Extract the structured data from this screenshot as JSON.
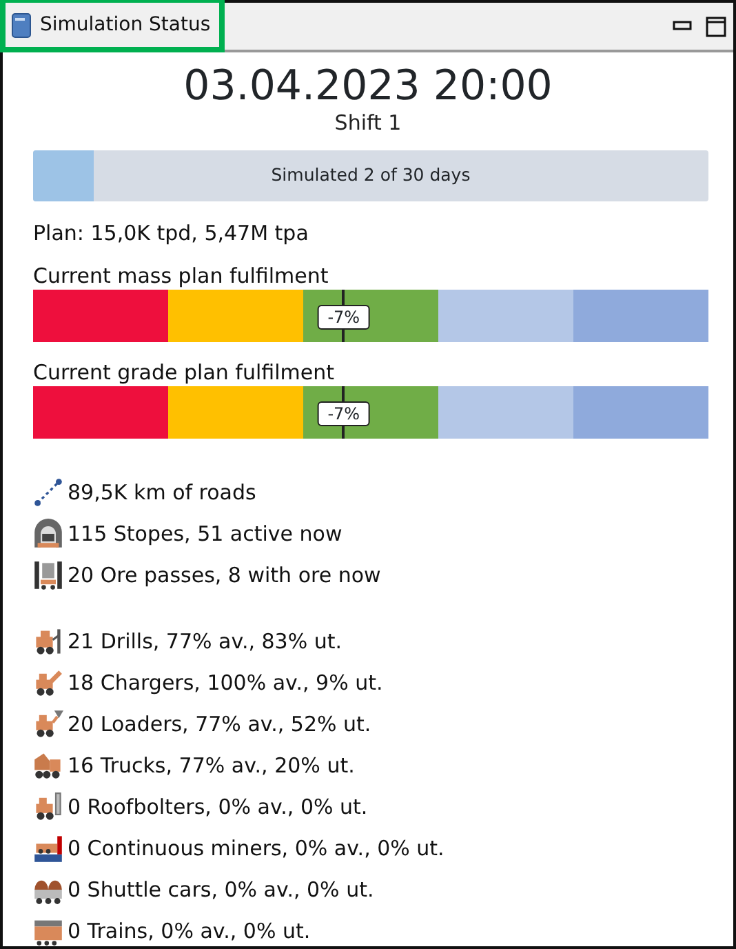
{
  "window": {
    "title": "Simulation Status",
    "buttons": [
      {
        "kind": "minimize"
      },
      {
        "kind": "maximize"
      }
    ]
  },
  "datetime": "03.04.2023 20:00",
  "shift": "Shift 1",
  "progress": {
    "label": "Simulated 2 of 30 days",
    "level": 0.09
  },
  "plan": "Plan: 15,0K tpd, 5,47M tpa",
  "fulfilment": [
    {
      "label": "Current mass plan fulfilment",
      "reading": "-7%",
      "level": 0.46,
      "segments": [
        {
          "color": "#ee0f3d"
        },
        {
          "color": "#ffc000"
        },
        {
          "color": "#70ad47"
        },
        {
          "color": "#b4c7e7"
        },
        {
          "color": "#8faadc"
        }
      ]
    },
    {
      "label": "Current grade plan fulfilment",
      "reading": "-7%",
      "level": 0.46,
      "segments": [
        {
          "color": "#ee0f3d"
        },
        {
          "color": "#ffc000"
        },
        {
          "color": "#70ad47"
        },
        {
          "color": "#b4c7e7"
        },
        {
          "color": "#8faadc"
        }
      ]
    }
  ],
  "infrastructure": [
    {
      "kind": "road",
      "text": "89,5K km of roads"
    },
    {
      "kind": "stope",
      "text": "115 Stopes, 51 active now"
    },
    {
      "kind": "orepass",
      "text": "20 Ore passes, 8 with ore now"
    }
  ],
  "equipment": [
    {
      "kind": "drill",
      "text": "21 Drills, 77% av., 83% ut."
    },
    {
      "kind": "charger",
      "text": "18 Chargers, 100% av., 9% ut."
    },
    {
      "kind": "loader",
      "text": "20 Loaders, 77% av., 52% ut."
    },
    {
      "kind": "truck",
      "text": "16 Trucks, 77% av., 20% ut."
    },
    {
      "kind": "roofbolter",
      "text": "0 Roofbolters, 0% av., 0% ut."
    },
    {
      "kind": "miner",
      "text": "0 Continuous miners, 0% av., 0% ut."
    },
    {
      "kind": "shuttle",
      "text": "0 Shuttle cars, 0% av., 0% ut."
    },
    {
      "kind": "train",
      "text": "0 Trains, 0% av., 0% ut."
    }
  ]
}
